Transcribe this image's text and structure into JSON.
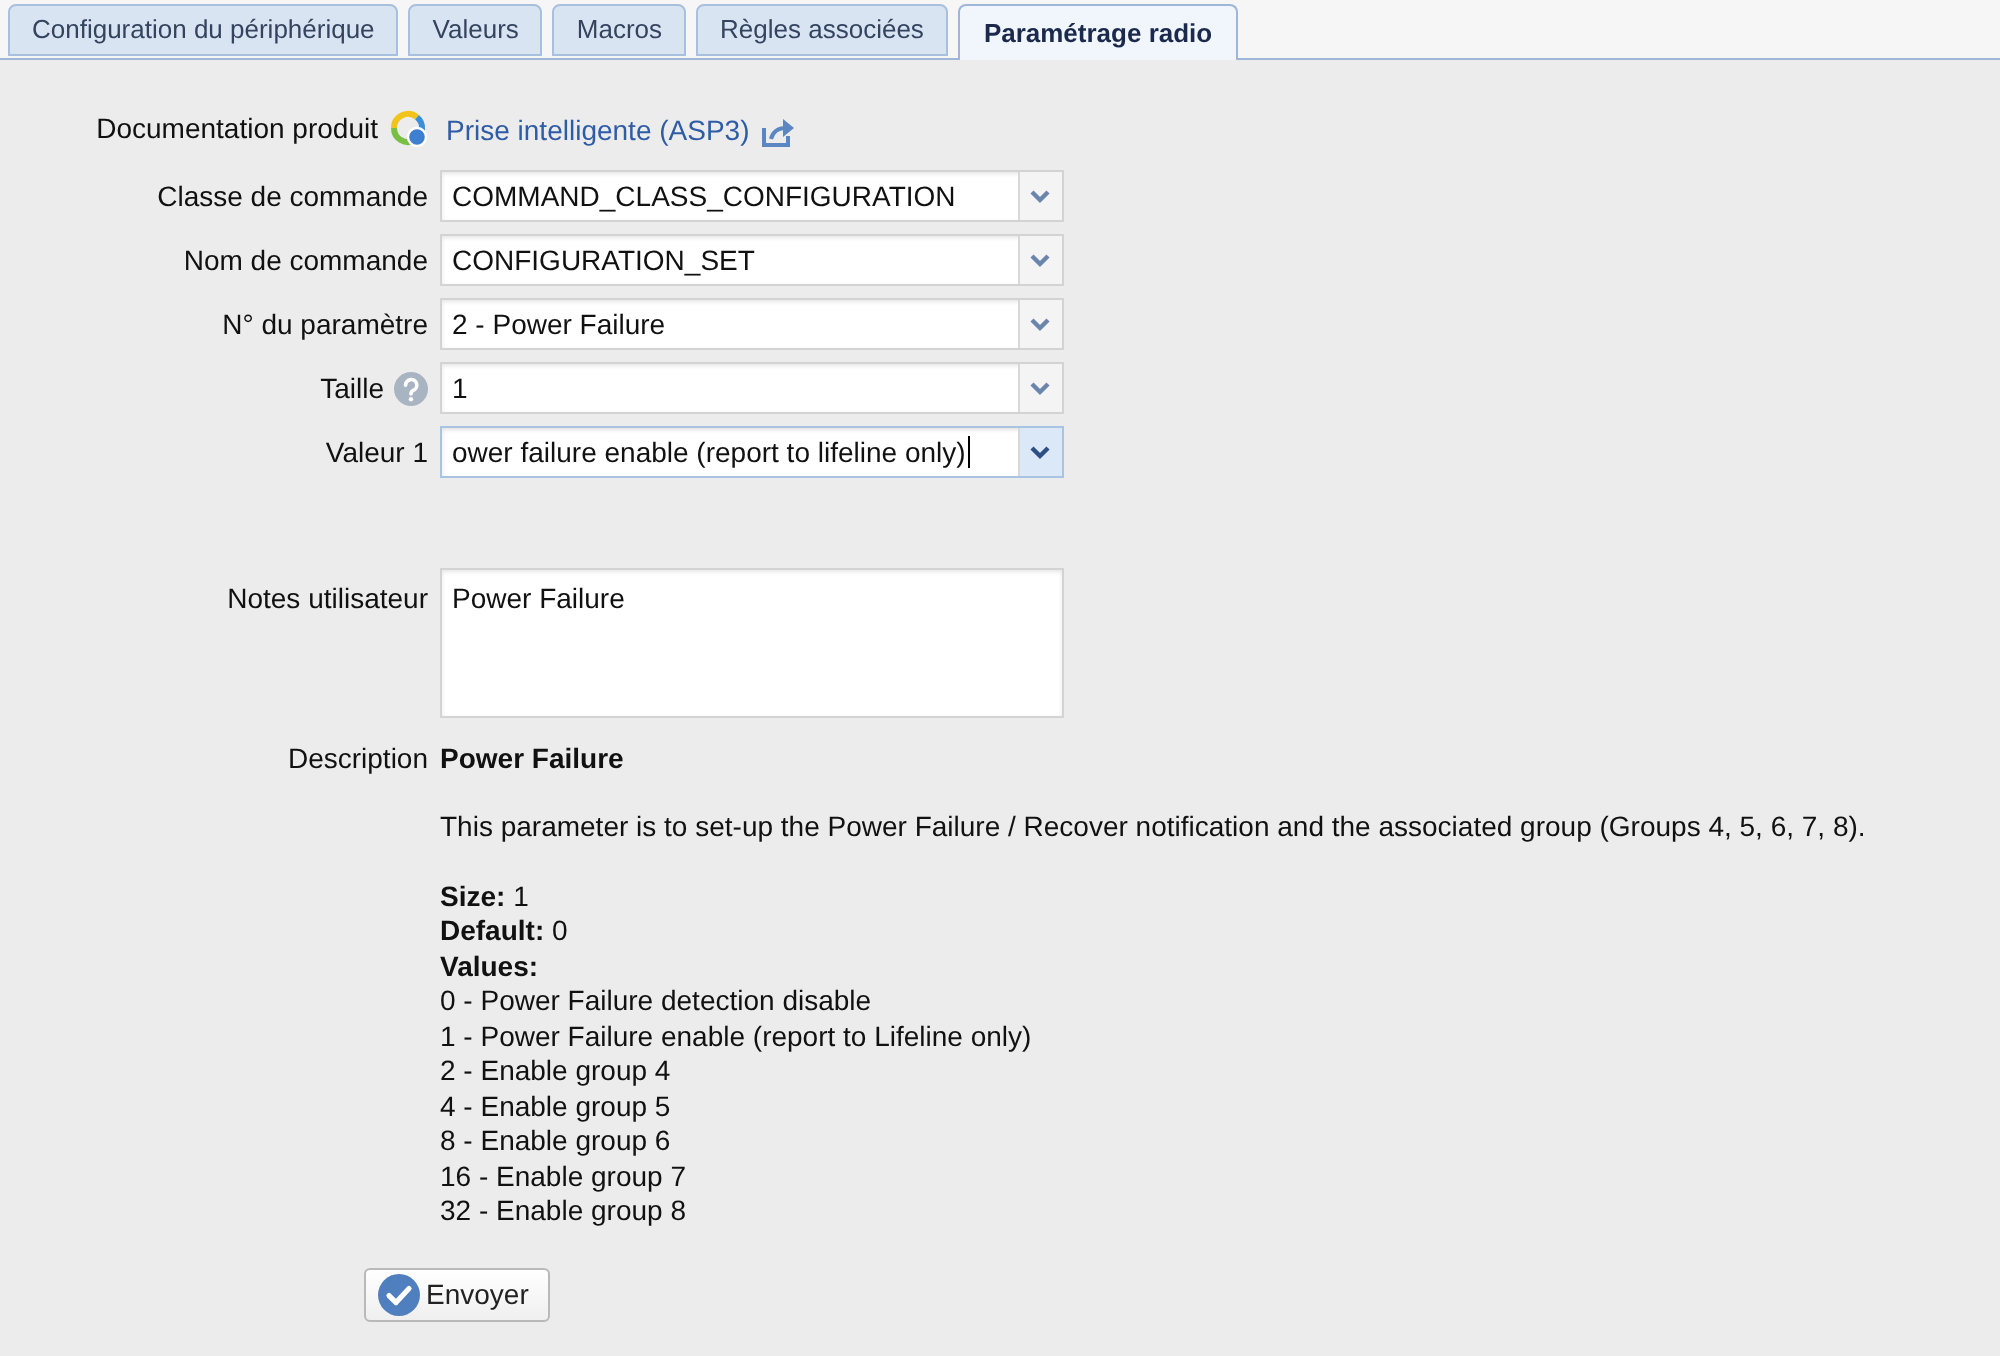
{
  "tabs": [
    {
      "label": "Configuration du périphérique",
      "selected": false
    },
    {
      "label": "Valeurs",
      "selected": false
    },
    {
      "label": "Macros",
      "selected": false
    },
    {
      "label": "Règles associées",
      "selected": false
    },
    {
      "label": "Paramétrage radio",
      "selected": true
    }
  ],
  "form": {
    "documentation": {
      "label": "Documentation produit",
      "link": "Prise intelligente (ASP3)"
    },
    "fields": [
      {
        "label": "Classe de commande",
        "value": "COMMAND_CLASS_CONFIGURATION",
        "help": false,
        "focused": false
      },
      {
        "label": "Nom de commande",
        "value": "CONFIGURATION_SET",
        "help": false,
        "focused": false
      },
      {
        "label": "N° du paramètre",
        "value": "2 - Power Failure",
        "help": false,
        "focused": false
      },
      {
        "label": "Taille",
        "value": "1",
        "help": true,
        "focused": false
      },
      {
        "label": "Valeur 1",
        "value": "ower failure enable (report to lifeline only)",
        "help": false,
        "focused": true
      }
    ],
    "notes": {
      "label": "Notes utilisateur",
      "value": "Power Failure"
    },
    "description": {
      "label": "Description",
      "title": "Power Failure",
      "paragraph": "This parameter is to set-up the Power Failure / Recover notification and the associated group (Groups 4, 5, 6, 7, 8).",
      "details": [
        "**Size:** 1",
        "**Default:** 0"
      ],
      "values_heading": "Values:",
      "values": [
        "0 - Power Failure detection disable",
        "1 - Power Failure enable (report to Lifeline only)",
        "2 - Enable group 4",
        "4 - Enable group 5",
        "8 - Enable group 6",
        "16 - Enable group 7",
        "32 - Enable group 8"
      ]
    }
  },
  "submit_button": {
    "label": "Envoyer"
  }
}
